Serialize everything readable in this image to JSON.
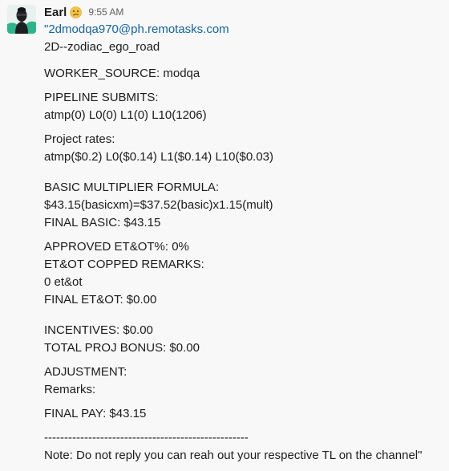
{
  "message": {
    "sender": "Earl",
    "status_emoji": "confused-face-icon",
    "timestamp": "9:55 AM",
    "email_prefix": "\"",
    "email": "2dmodqa970@ph.remotasks.com",
    "project": "2D--zodiac_ego_road",
    "worker_source": "WORKER_SOURCE: modqa",
    "pipeline_label": "PIPELINE SUBMITS:",
    "pipeline_values": "atmp(0) L0(0) L1(0) L10(1206)",
    "rates_label": "Project rates:",
    "rates_values": "atmp($0.2) L0($0.14) L1($0.14) L10($0.03)",
    "formula_label": "BASIC MULTIPLIER FORMULA:",
    "formula_value": "$43.15(basicxm)=$37.52(basic)x1.15(mult)",
    "final_basic": "FINAL BASIC: $43.15",
    "approved_etot": "APPROVED ET&OT%: 0%",
    "copped_label": "ET&OT COPPED REMARKS:",
    "copped_value": "0 et&ot",
    "final_etot": "FINAL ET&OT: $0.00",
    "incentives": "INCENTIVES: $0.00",
    "total_proj_bonus": "TOTAL PROJ BONUS: $0.00",
    "adjustment": "ADJUSTMENT:",
    "remarks": "Remarks:",
    "final_pay": "FINAL PAY: $43.15",
    "divider": "---------------------------------------------------",
    "note": "Note: Do not reply you can reah out your respective TL on the channel\""
  },
  "colors": {
    "link": "#1264a3",
    "text": "#1d1c1d",
    "timestamp": "#616061",
    "background": "#f8f8f8",
    "avatar_bg": "#2bb58a"
  }
}
